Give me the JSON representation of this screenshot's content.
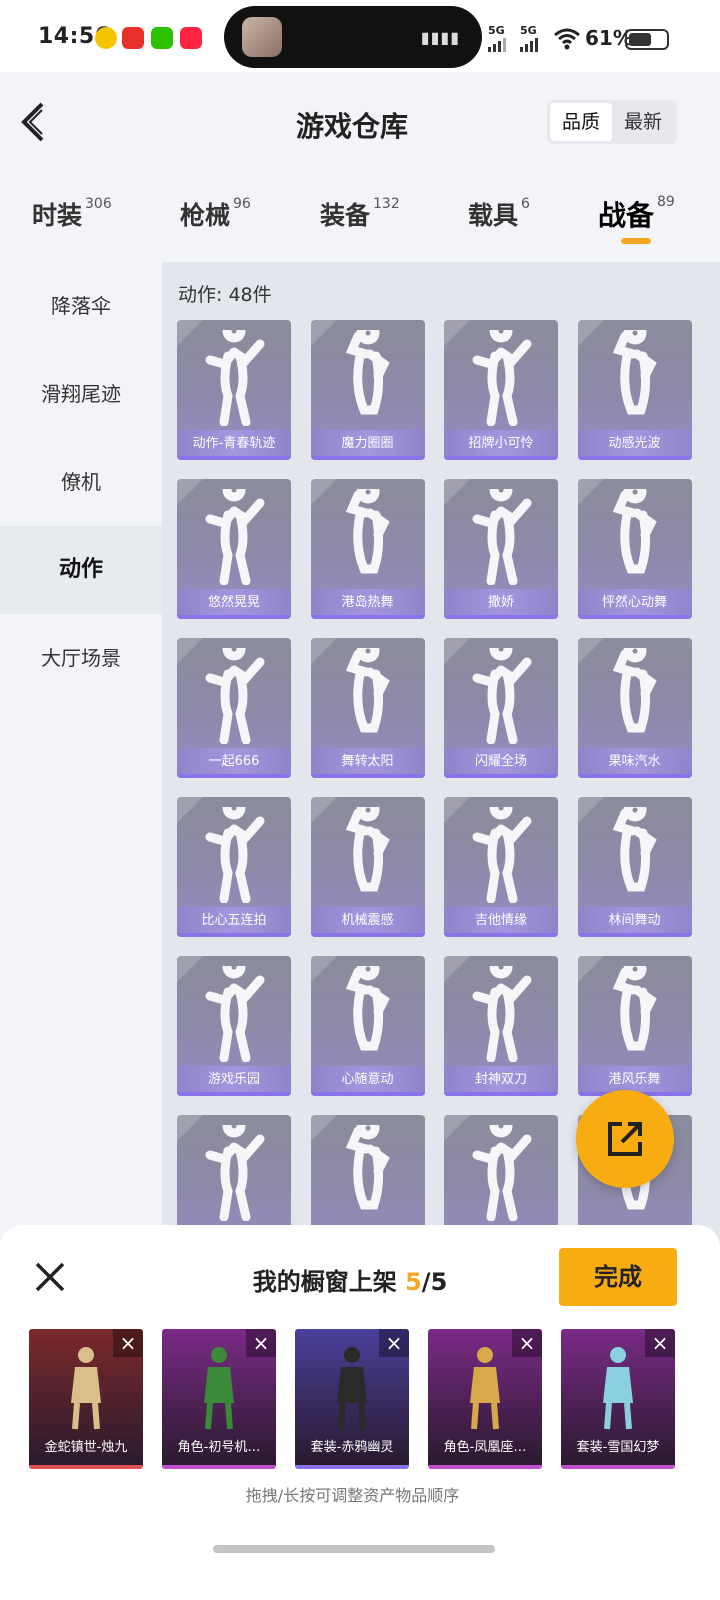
{
  "status_bar": {
    "time": "14:56",
    "signal1": "5G",
    "signal2": "5G",
    "battery": "61%"
  },
  "header": {
    "title": "游戏仓库",
    "sort_options": [
      "品质",
      "最新"
    ],
    "back_icon": "back-arrow-icon"
  },
  "tabs": [
    {
      "label": "时装",
      "count": "306"
    },
    {
      "label": "枪械",
      "count": "96"
    },
    {
      "label": "装备",
      "count": "132"
    },
    {
      "label": "载具",
      "count": "6"
    },
    {
      "label": "战备",
      "count": "89"
    }
  ],
  "sidebar": {
    "items": [
      "降落伞",
      "滑翔尾迹",
      "僚机",
      "动作",
      "大厅场景"
    ]
  },
  "main": {
    "count_label": "动作: 48件",
    "items": [
      "动作-青春轨迹",
      "魔力圈圈",
      "招牌小可怜",
      "动感光波",
      "悠然晃晃",
      "港岛热舞",
      "撒娇",
      "怦然心动舞",
      "一起666",
      "舞转太阳",
      "闪耀全场",
      "果味汽水",
      "比心五连拍",
      "机械震感",
      "吉他情缘",
      "林间舞动",
      "游戏乐园",
      "心随意动",
      "封神双刀",
      "港风乐舞",
      "",
      "",
      "",
      ""
    ]
  },
  "fab": {
    "icon": "share-export-icon"
  },
  "sheet": {
    "title_prefix": "我的橱窗上架",
    "current": "5",
    "total": "/5",
    "done_label": "完成",
    "items": [
      {
        "name": "金蛇镇世-烛九",
        "bg": "#7a2a2a",
        "fig": "#d9c08a"
      },
      {
        "name": "角色-初号机…",
        "bg": "#7a2a86",
        "fig": "#3a8a3a"
      },
      {
        "name": "套装-赤鸦幽灵",
        "bg": "#4a3f9a",
        "fig": "#2a2a2a"
      },
      {
        "name": "角色-凤凰座…",
        "bg": "#7a2a86",
        "fig": "#d9a84a"
      },
      {
        "name": "套装-雪国幻梦",
        "bg": "#7a2a86",
        "fig": "#8ad0e0"
      }
    ],
    "hint": "拖拽/长按可调整资产物品顺序"
  }
}
